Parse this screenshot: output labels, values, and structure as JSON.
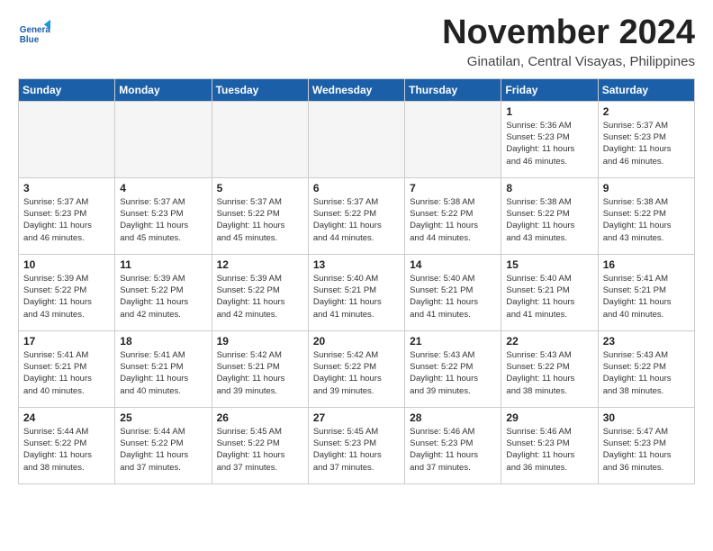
{
  "header": {
    "logo_line1": "General",
    "logo_line2": "Blue",
    "month": "November 2024",
    "location": "Ginatilan, Central Visayas, Philippines"
  },
  "weekdays": [
    "Sunday",
    "Monday",
    "Tuesday",
    "Wednesday",
    "Thursday",
    "Friday",
    "Saturday"
  ],
  "weeks": [
    [
      {
        "day": "",
        "info": ""
      },
      {
        "day": "",
        "info": ""
      },
      {
        "day": "",
        "info": ""
      },
      {
        "day": "",
        "info": ""
      },
      {
        "day": "",
        "info": ""
      },
      {
        "day": "1",
        "info": "Sunrise: 5:36 AM\nSunset: 5:23 PM\nDaylight: 11 hours\nand 46 minutes."
      },
      {
        "day": "2",
        "info": "Sunrise: 5:37 AM\nSunset: 5:23 PM\nDaylight: 11 hours\nand 46 minutes."
      }
    ],
    [
      {
        "day": "3",
        "info": "Sunrise: 5:37 AM\nSunset: 5:23 PM\nDaylight: 11 hours\nand 46 minutes."
      },
      {
        "day": "4",
        "info": "Sunrise: 5:37 AM\nSunset: 5:23 PM\nDaylight: 11 hours\nand 45 minutes."
      },
      {
        "day": "5",
        "info": "Sunrise: 5:37 AM\nSunset: 5:22 PM\nDaylight: 11 hours\nand 45 minutes."
      },
      {
        "day": "6",
        "info": "Sunrise: 5:37 AM\nSunset: 5:22 PM\nDaylight: 11 hours\nand 44 minutes."
      },
      {
        "day": "7",
        "info": "Sunrise: 5:38 AM\nSunset: 5:22 PM\nDaylight: 11 hours\nand 44 minutes."
      },
      {
        "day": "8",
        "info": "Sunrise: 5:38 AM\nSunset: 5:22 PM\nDaylight: 11 hours\nand 43 minutes."
      },
      {
        "day": "9",
        "info": "Sunrise: 5:38 AM\nSunset: 5:22 PM\nDaylight: 11 hours\nand 43 minutes."
      }
    ],
    [
      {
        "day": "10",
        "info": "Sunrise: 5:39 AM\nSunset: 5:22 PM\nDaylight: 11 hours\nand 43 minutes."
      },
      {
        "day": "11",
        "info": "Sunrise: 5:39 AM\nSunset: 5:22 PM\nDaylight: 11 hours\nand 42 minutes."
      },
      {
        "day": "12",
        "info": "Sunrise: 5:39 AM\nSunset: 5:22 PM\nDaylight: 11 hours\nand 42 minutes."
      },
      {
        "day": "13",
        "info": "Sunrise: 5:40 AM\nSunset: 5:21 PM\nDaylight: 11 hours\nand 41 minutes."
      },
      {
        "day": "14",
        "info": "Sunrise: 5:40 AM\nSunset: 5:21 PM\nDaylight: 11 hours\nand 41 minutes."
      },
      {
        "day": "15",
        "info": "Sunrise: 5:40 AM\nSunset: 5:21 PM\nDaylight: 11 hours\nand 41 minutes."
      },
      {
        "day": "16",
        "info": "Sunrise: 5:41 AM\nSunset: 5:21 PM\nDaylight: 11 hours\nand 40 minutes."
      }
    ],
    [
      {
        "day": "17",
        "info": "Sunrise: 5:41 AM\nSunset: 5:21 PM\nDaylight: 11 hours\nand 40 minutes."
      },
      {
        "day": "18",
        "info": "Sunrise: 5:41 AM\nSunset: 5:21 PM\nDaylight: 11 hours\nand 40 minutes."
      },
      {
        "day": "19",
        "info": "Sunrise: 5:42 AM\nSunset: 5:21 PM\nDaylight: 11 hours\nand 39 minutes."
      },
      {
        "day": "20",
        "info": "Sunrise: 5:42 AM\nSunset: 5:22 PM\nDaylight: 11 hours\nand 39 minutes."
      },
      {
        "day": "21",
        "info": "Sunrise: 5:43 AM\nSunset: 5:22 PM\nDaylight: 11 hours\nand 39 minutes."
      },
      {
        "day": "22",
        "info": "Sunrise: 5:43 AM\nSunset: 5:22 PM\nDaylight: 11 hours\nand 38 minutes."
      },
      {
        "day": "23",
        "info": "Sunrise: 5:43 AM\nSunset: 5:22 PM\nDaylight: 11 hours\nand 38 minutes."
      }
    ],
    [
      {
        "day": "24",
        "info": "Sunrise: 5:44 AM\nSunset: 5:22 PM\nDaylight: 11 hours\nand 38 minutes."
      },
      {
        "day": "25",
        "info": "Sunrise: 5:44 AM\nSunset: 5:22 PM\nDaylight: 11 hours\nand 37 minutes."
      },
      {
        "day": "26",
        "info": "Sunrise: 5:45 AM\nSunset: 5:22 PM\nDaylight: 11 hours\nand 37 minutes."
      },
      {
        "day": "27",
        "info": "Sunrise: 5:45 AM\nSunset: 5:23 PM\nDaylight: 11 hours\nand 37 minutes."
      },
      {
        "day": "28",
        "info": "Sunrise: 5:46 AM\nSunset: 5:23 PM\nDaylight: 11 hours\nand 37 minutes."
      },
      {
        "day": "29",
        "info": "Sunrise: 5:46 AM\nSunset: 5:23 PM\nDaylight: 11 hours\nand 36 minutes."
      },
      {
        "day": "30",
        "info": "Sunrise: 5:47 AM\nSunset: 5:23 PM\nDaylight: 11 hours\nand 36 minutes."
      }
    ]
  ]
}
